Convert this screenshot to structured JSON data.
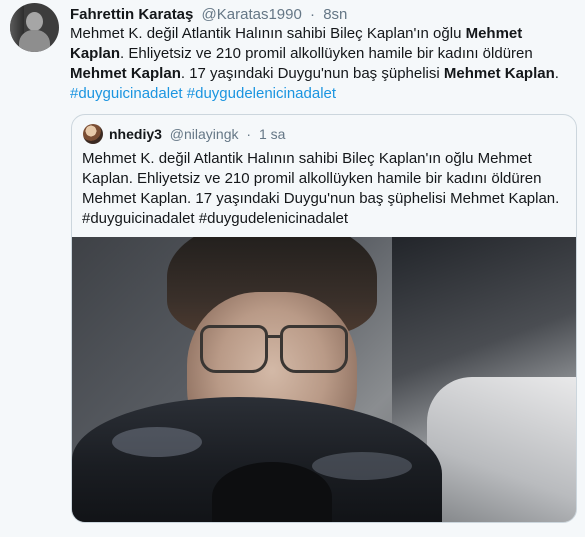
{
  "tweet": {
    "author_name": "Fahrettin Karataş",
    "author_handle": "@Karatas1990",
    "separator": "·",
    "time": "8sn",
    "text_parts": [
      {
        "t": "Mehmet K. değil Atlantik Halının sahibi Bileç Kaplan'ın oğlu ",
        "style": "normal"
      },
      {
        "t": "Mehmet Kaplan",
        "style": "bold"
      },
      {
        "t": ". Ehliyetsiz ve 210 promil alkollüyken hamile bir kadını öldüren ",
        "style": "normal"
      },
      {
        "t": "Mehmet Kaplan",
        "style": "bold"
      },
      {
        "t": ". 17 yaşındaki Duygu'nun baş şüphelisi ",
        "style": "normal"
      },
      {
        "t": "Mehmet Kaplan",
        "style": "bold"
      },
      {
        "t": ". ",
        "style": "normal"
      },
      {
        "t": "#duyguicinadalet",
        "style": "hashtag"
      },
      {
        "t": " ",
        "style": "normal"
      },
      {
        "t": "#duygudelenicinadalet",
        "style": "hashtag"
      }
    ]
  },
  "quoted": {
    "author_name": "nhediy3",
    "author_handle": "@nilayingk",
    "separator": "·",
    "time": "1 sa",
    "text": "Mehmet K. değil Atlantik Halının sahibi Bileç Kaplan'ın oğlu Mehmet Kaplan. Ehliyetsiz ve 210 promil alkollüyken hamile bir kadını öldüren Mehmet Kaplan. 17 yaşındaki Duygu'nun baş şüphelisi Mehmet Kaplan. #duyguicinadalet #duygudelenicinadalet",
    "photo_subject": "selfie-photo"
  },
  "colors": {
    "background": "#f5f8fa",
    "text": "#14171a",
    "muted": "#657786",
    "link": "#1b95e0",
    "border": "#ccd6dd"
  }
}
